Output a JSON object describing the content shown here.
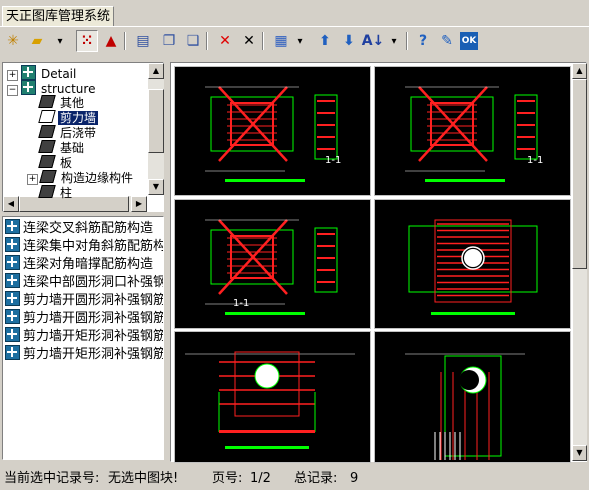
{
  "window": {
    "tab_title": "天正图库管理系统"
  },
  "toolbar": {
    "buttons": [
      {
        "name": "new-icon",
        "glyph": "✳"
      },
      {
        "name": "open-folder-icon",
        "glyph": "▰"
      },
      {
        "name": "dropdown-arrow-icon",
        "glyph": "▾"
      },
      {
        "name": "grid-view-icon",
        "glyph": "⁙"
      },
      {
        "name": "triangle-view-icon",
        "glyph": "▲"
      },
      {
        "name": "table-icon",
        "glyph": "▤"
      },
      {
        "name": "copy-icon",
        "glyph": "❐"
      },
      {
        "name": "paste-icon",
        "glyph": "❏"
      },
      {
        "name": "delete-red-icon",
        "glyph": "✕"
      },
      {
        "name": "delete-black-icon",
        "glyph": "✕"
      },
      {
        "name": "layout-icon",
        "glyph": "▦"
      },
      {
        "name": "layout-dropdown-icon",
        "glyph": "▾"
      },
      {
        "name": "move-up-icon",
        "glyph": "⬆"
      },
      {
        "name": "move-down-icon",
        "glyph": "⬇"
      },
      {
        "name": "sort-az-icon",
        "glyph": "A↓"
      },
      {
        "name": "sort-dropdown-icon",
        "glyph": "▾"
      },
      {
        "name": "help-icon",
        "glyph": "?"
      },
      {
        "name": "edit-icon",
        "glyph": "✎"
      },
      {
        "name": "ok-icon",
        "glyph": "OK"
      }
    ]
  },
  "tree": {
    "nodes": [
      {
        "label": "Detail",
        "level": 0,
        "expander": "+"
      },
      {
        "label": "structure",
        "level": 0,
        "expander": "-"
      },
      {
        "label": "其他",
        "level": 1,
        "expander": ""
      },
      {
        "label": "剪力墙",
        "level": 1,
        "expander": "",
        "selected": true
      },
      {
        "label": "后浇带",
        "level": 1,
        "expander": ""
      },
      {
        "label": "基础",
        "level": 1,
        "expander": ""
      },
      {
        "label": "板",
        "level": 1,
        "expander": ""
      },
      {
        "label": "构造边缘构件",
        "level": 1,
        "expander": "+"
      },
      {
        "label": "柱",
        "level": 1,
        "expander": ""
      }
    ]
  },
  "list": {
    "items": [
      "连梁交叉斜筋配筋构造",
      "连梁集中对角斜筋配筋构",
      "连梁对角暗撑配筋构造",
      "连梁中部圆形洞口补强钢",
      "剪力墙开圆形洞补强钢筋",
      "剪力墙开圆形洞补强钢筋",
      "剪力墙开矩形洞补强钢筋",
      "剪力墙开矩形洞补强钢筋"
    ]
  },
  "thumbnails": [
    {
      "section": "1-1"
    },
    {
      "section": "1-1"
    },
    {
      "section": "1-1"
    },
    {
      "section": ""
    },
    {
      "section": ""
    },
    {
      "section": ""
    }
  ],
  "status": {
    "record_label": "当前选中记录号:",
    "record_value": "无选中图块!",
    "page_label": "页号:",
    "page_value": "1/2",
    "total_label": "总记录:",
    "total_value": "9"
  },
  "colors": {
    "drawing_bg": "#000000",
    "rebar_red": "#ff0000",
    "outline_green": "#00ff00",
    "dim_white": "#ffffff"
  }
}
